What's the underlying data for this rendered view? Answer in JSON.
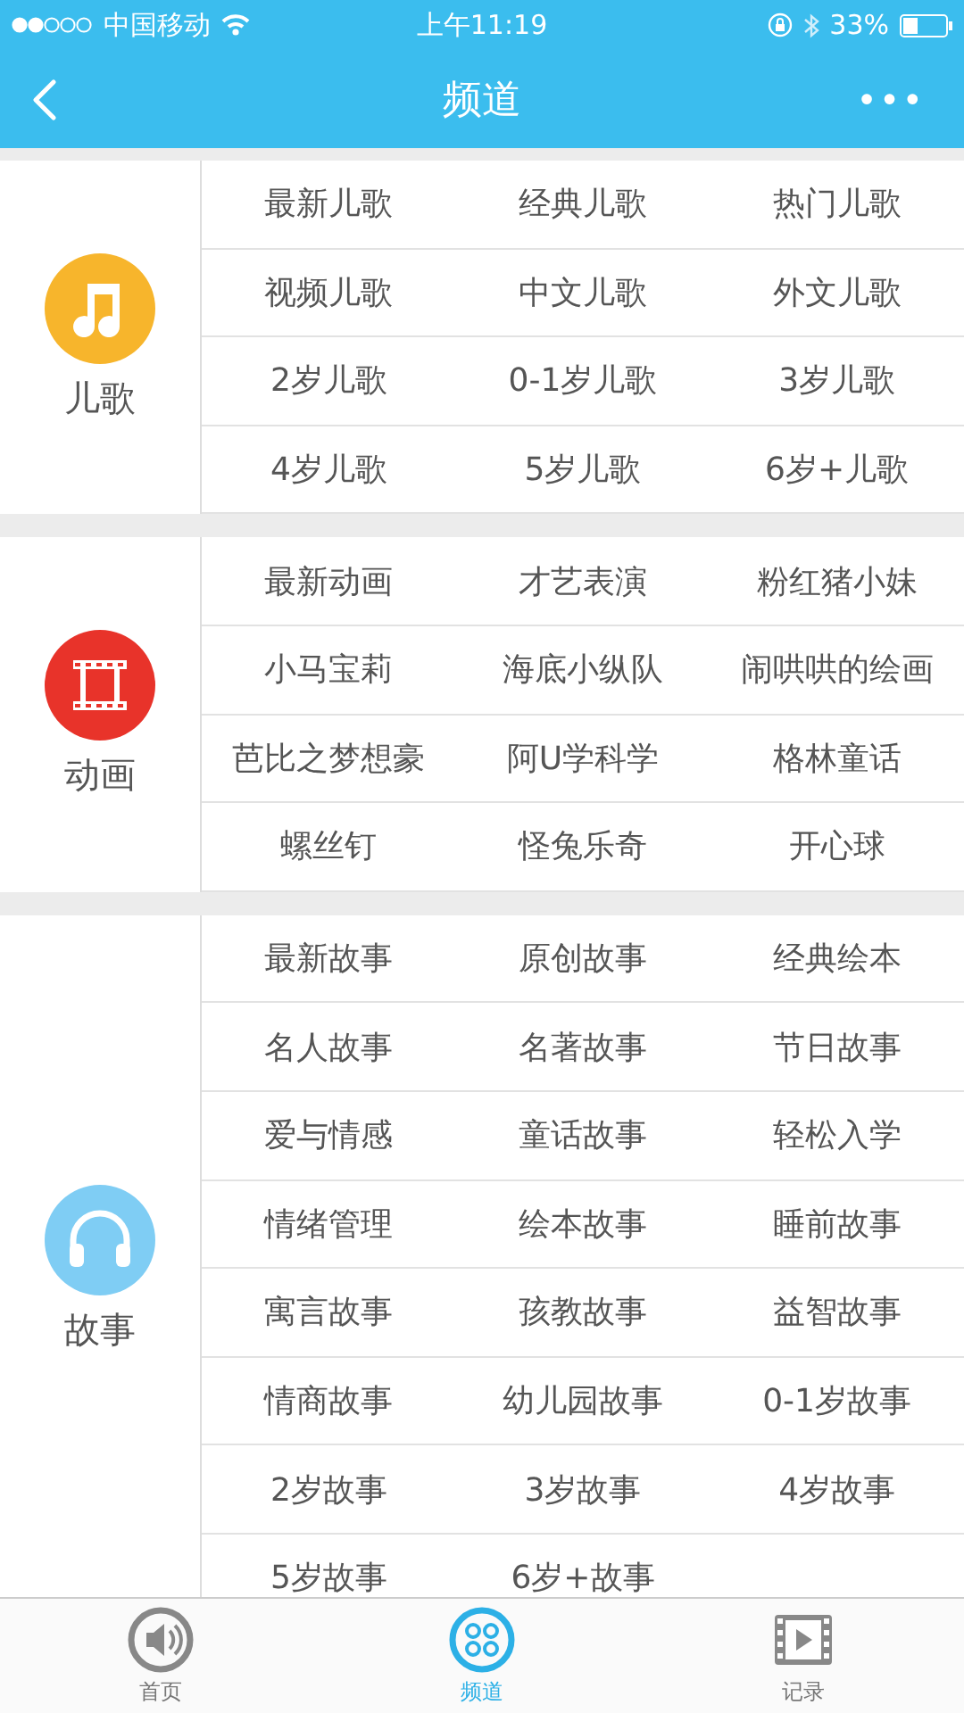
{
  "status_bar": {
    "carrier": "中国移动",
    "time": "上午11:19",
    "battery": "33%"
  },
  "nav": {
    "title": "频道",
    "more": "•••"
  },
  "sections": [
    {
      "name": "儿歌",
      "kind": "music",
      "color": "#f7b52c",
      "items": [
        "最新儿歌",
        "经典儿歌",
        "热门儿歌",
        "视频儿歌",
        "中文儿歌",
        "外文儿歌",
        "2岁儿歌",
        "0-1岁儿歌",
        "3岁儿歌",
        "4岁儿歌",
        "5岁儿歌",
        "6岁+儿歌"
      ]
    },
    {
      "name": "动画",
      "kind": "film",
      "color": "#e8332a",
      "items": [
        "最新动画",
        "才艺表演",
        "粉红猪小妹",
        "小马宝莉",
        "海底小纵队",
        "闹哄哄的绘画",
        "芭比之梦想豪",
        "阿U学科学",
        "格林童话",
        "螺丝钉",
        "怪兔乐奇",
        "开心球"
      ]
    },
    {
      "name": "故事",
      "kind": "headphones",
      "color": "#7fcdf4",
      "items": [
        "最新故事",
        "原创故事",
        "经典绘本",
        "名人故事",
        "名著故事",
        "节日故事",
        "爱与情感",
        "童话故事",
        "轻松入学",
        "情绪管理",
        "绘本故事",
        "睡前故事",
        "寓言故事",
        "孩教故事",
        "益智故事",
        "情商故事",
        "幼儿园故事",
        "0-1岁故事",
        "2岁故事",
        "3岁故事",
        "4岁故事",
        "5岁故事",
        "6岁+故事"
      ]
    }
  ],
  "tabs": [
    {
      "label": "首页",
      "kind": "speaker",
      "selected": false
    },
    {
      "label": "频道",
      "kind": "grid",
      "selected": true
    },
    {
      "label": "记录",
      "kind": "film",
      "selected": false
    }
  ]
}
